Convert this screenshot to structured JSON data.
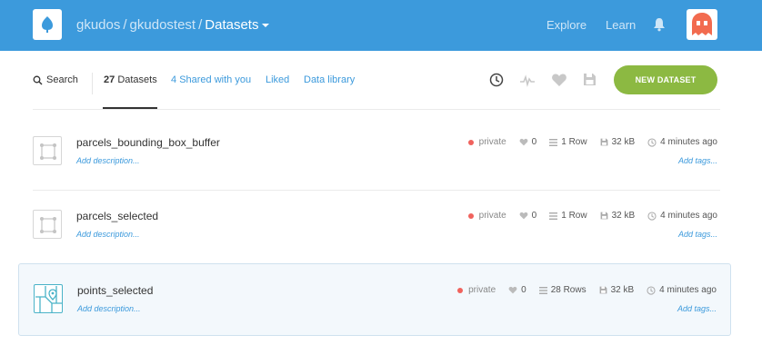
{
  "header": {
    "user": "gkudos",
    "org": "gkudostest",
    "section": "Datasets",
    "nav": [
      "Explore",
      "Learn"
    ]
  },
  "filters": {
    "search_label": "Search",
    "count": "27",
    "count_label": "Datasets",
    "shared_count": "4",
    "shared_label": "Shared with you",
    "liked": "Liked",
    "library": "Data library",
    "new_button": "NEW DATASET"
  },
  "datasets": [
    {
      "name": "parcels_bounding_box_buffer",
      "description": "Add description...",
      "privacy": "private",
      "likes": "0",
      "rows": "1 Row",
      "size": "32 kB",
      "updated": "4 minutes ago",
      "tags": "Add tags...",
      "geometry": "polygon"
    },
    {
      "name": "parcels_selected",
      "description": "Add description...",
      "privacy": "private",
      "likes": "0",
      "rows": "1 Row",
      "size": "32 kB",
      "updated": "4 minutes ago",
      "tags": "Add tags...",
      "geometry": "polygon"
    },
    {
      "name": "points_selected",
      "description": "Add description...",
      "privacy": "private",
      "likes": "0",
      "rows": "28 Rows",
      "size": "32 kB",
      "updated": "4 minutes ago",
      "tags": "Add tags...",
      "geometry": "point"
    }
  ],
  "colors": {
    "topbar": "#3c9adc",
    "accent_link": "#3c9adc",
    "new_button": "#8cb942",
    "private_dot": "#f0625d",
    "avatar": "#f26b4f",
    "selected_row": "#f3f8fc"
  }
}
